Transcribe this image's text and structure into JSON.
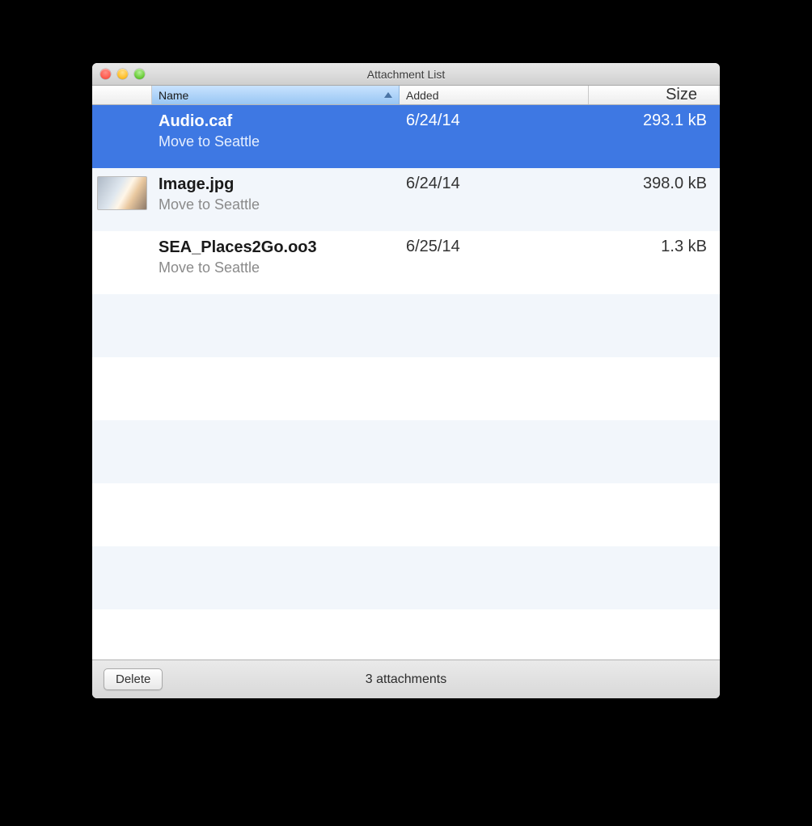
{
  "window": {
    "title": "Attachment List"
  },
  "columns": {
    "name": "Name",
    "added": "Added",
    "size": "Size"
  },
  "rows": [
    {
      "filename": "Audio.caf",
      "subtitle": "Move to Seattle",
      "added": "6/24/14",
      "size": "293.1 kB",
      "selected": true,
      "thumb": false
    },
    {
      "filename": "Image.jpg",
      "subtitle": "Move to Seattle",
      "added": "6/24/14",
      "size": "398.0 kB",
      "selected": false,
      "thumb": true
    },
    {
      "filename": "SEA_Places2Go.oo3",
      "subtitle": "Move to Seattle",
      "added": "6/25/14",
      "size": "1.3 kB",
      "selected": false,
      "thumb": false
    }
  ],
  "footer": {
    "delete_label": "Delete",
    "status": "3 attachments"
  }
}
